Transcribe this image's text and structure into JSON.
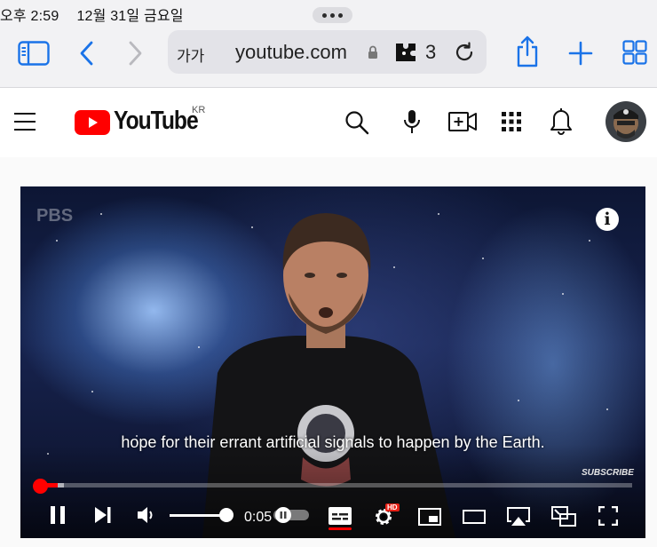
{
  "status_bar": {
    "time": "오후 2:59",
    "date": "12월 31일 금요일"
  },
  "browser": {
    "text_size_label": "가가",
    "url": "youtube.com",
    "extension_count": "3"
  },
  "youtube": {
    "logo_text": "YouTube",
    "region": "KR"
  },
  "video": {
    "channel_watermark": "PBS",
    "info_label": "i",
    "caption": "hope for their errant artificial signals to happen by the Earth.",
    "subscribe_label": "SUBSCRIBE",
    "current_time": "0:05",
    "progress_played": 0.03,
    "progress_buffered": 0.04,
    "volume_level": 0.88,
    "hd_badge": "HD"
  },
  "colors": {
    "youtube_red": "#ff0000",
    "safari_blue": "#1a73e8"
  }
}
